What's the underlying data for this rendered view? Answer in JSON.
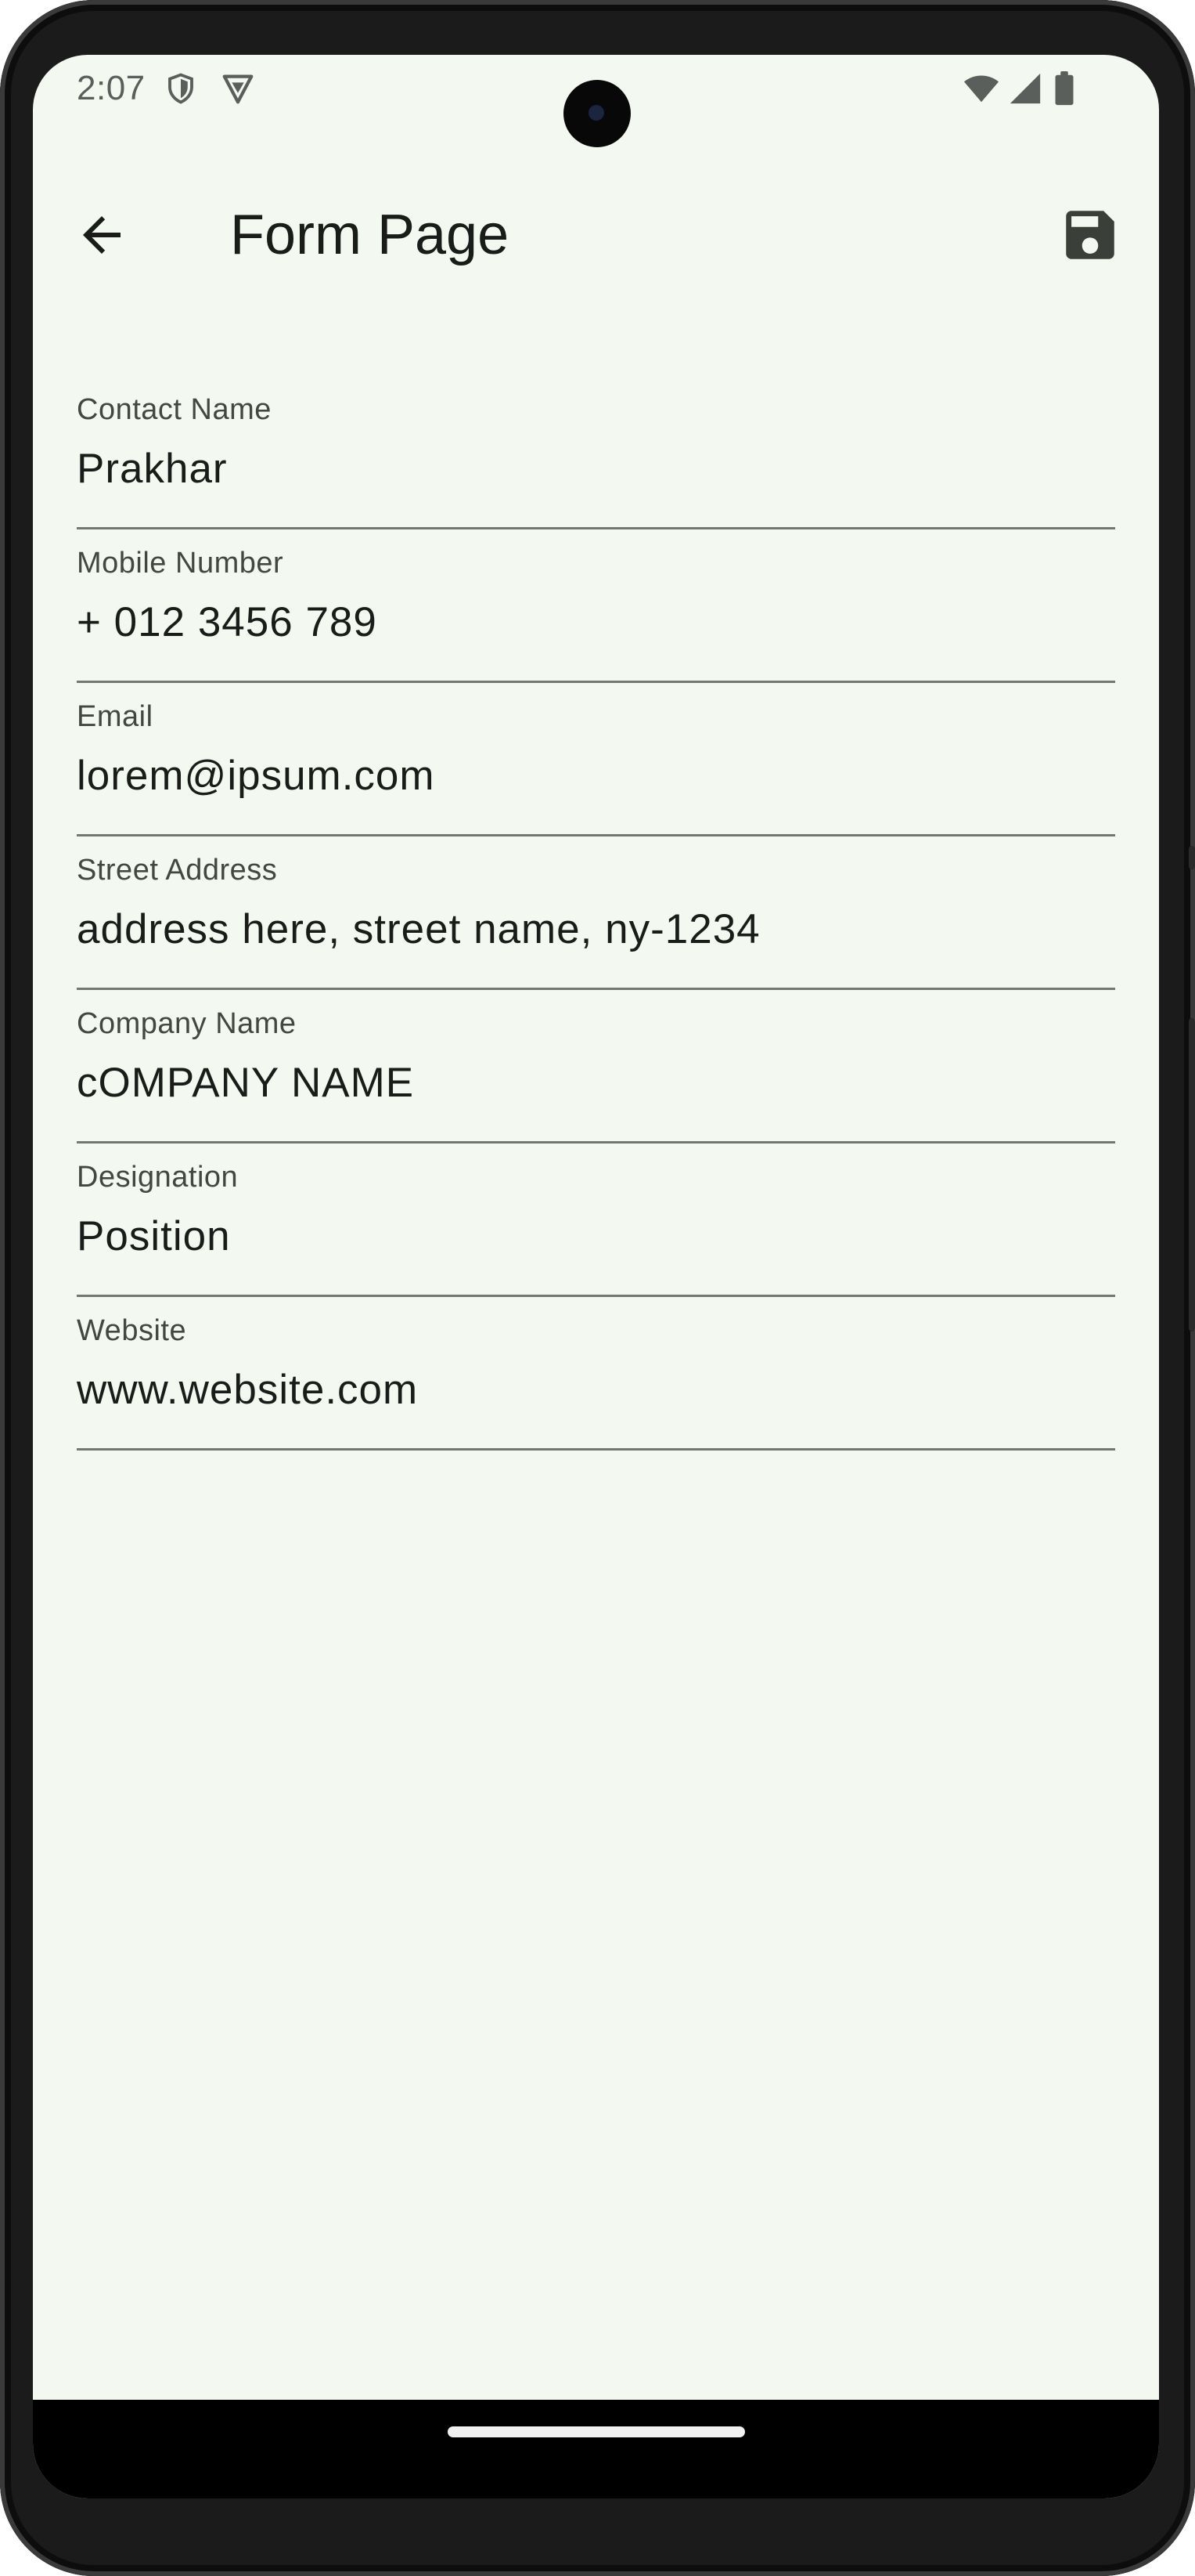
{
  "status_bar": {
    "time": "2:07",
    "icons": [
      "shield-icon",
      "vpn-icon",
      "wifi-icon",
      "signal-icon",
      "battery-icon"
    ]
  },
  "app_bar": {
    "title": "Form Page",
    "back_icon": "arrow-back-icon",
    "save_icon": "save-icon"
  },
  "form": {
    "fields": [
      {
        "label": "Contact Name",
        "value": "Prakhar"
      },
      {
        "label": "Mobile Number",
        "value": "+ 012 3456 789"
      },
      {
        "label": "Email",
        "value": "lorem@ipsum.com"
      },
      {
        "label": "Street Address",
        "value": "address here, street name, ny-1234"
      },
      {
        "label": "Company Name",
        "value": "cOMPANY NAME"
      },
      {
        "label": "Designation",
        "value": "Position"
      },
      {
        "label": "Website",
        "value": "www.website.com"
      }
    ]
  },
  "colors": {
    "background": "#f3f8f0",
    "text_primary": "#1a1c19",
    "text_label": "#42473f",
    "underline": "#72776f"
  }
}
